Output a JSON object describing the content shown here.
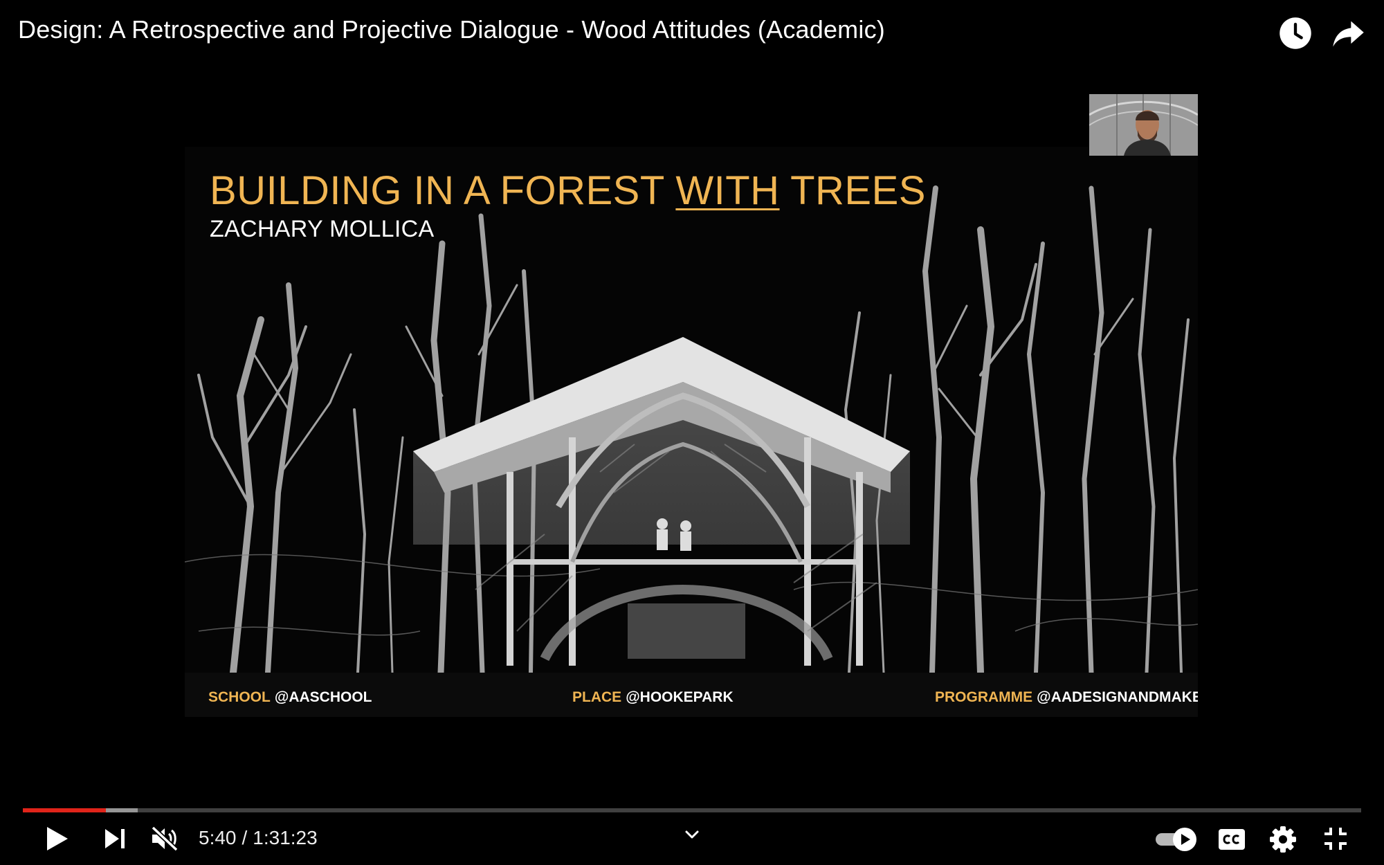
{
  "header": {
    "title": "Design: A Retrospective and Projective Dialogue - Wood Attitudes (Academic)",
    "watch_later_icon": "clock-icon",
    "share_icon": "share-arrow-icon"
  },
  "slide": {
    "title_pre": "BUILDING IN A FOREST ",
    "title_emph": "WITH",
    "title_post": " TREES",
    "author": "ZACHARY MOLLICA",
    "credits": [
      {
        "key": "SCHOOL",
        "value": "@AASCHOOL"
      },
      {
        "key": "PLACE",
        "value": "@HOOKEPARK"
      },
      {
        "key": "PROGRAMME",
        "value": "@AADESIGNANDMAKE"
      }
    ],
    "accent_color": "#f0b553"
  },
  "player": {
    "current_time": "5:40",
    "separator": "/",
    "duration": "1:31:23",
    "played_fraction": 0.062,
    "buffered_fraction": 0.086,
    "progress_color": "#e1241a",
    "muted": true,
    "autoplay_on": true,
    "icons": {
      "play": "play-icon",
      "next": "next-icon",
      "mute": "volume-muted-icon",
      "chevron": "chevron-down-icon",
      "autoplay": "autoplay-toggle-icon",
      "captions": "cc-icon",
      "settings": "gear-icon",
      "exit_fullscreen": "exit-fullscreen-icon"
    }
  }
}
